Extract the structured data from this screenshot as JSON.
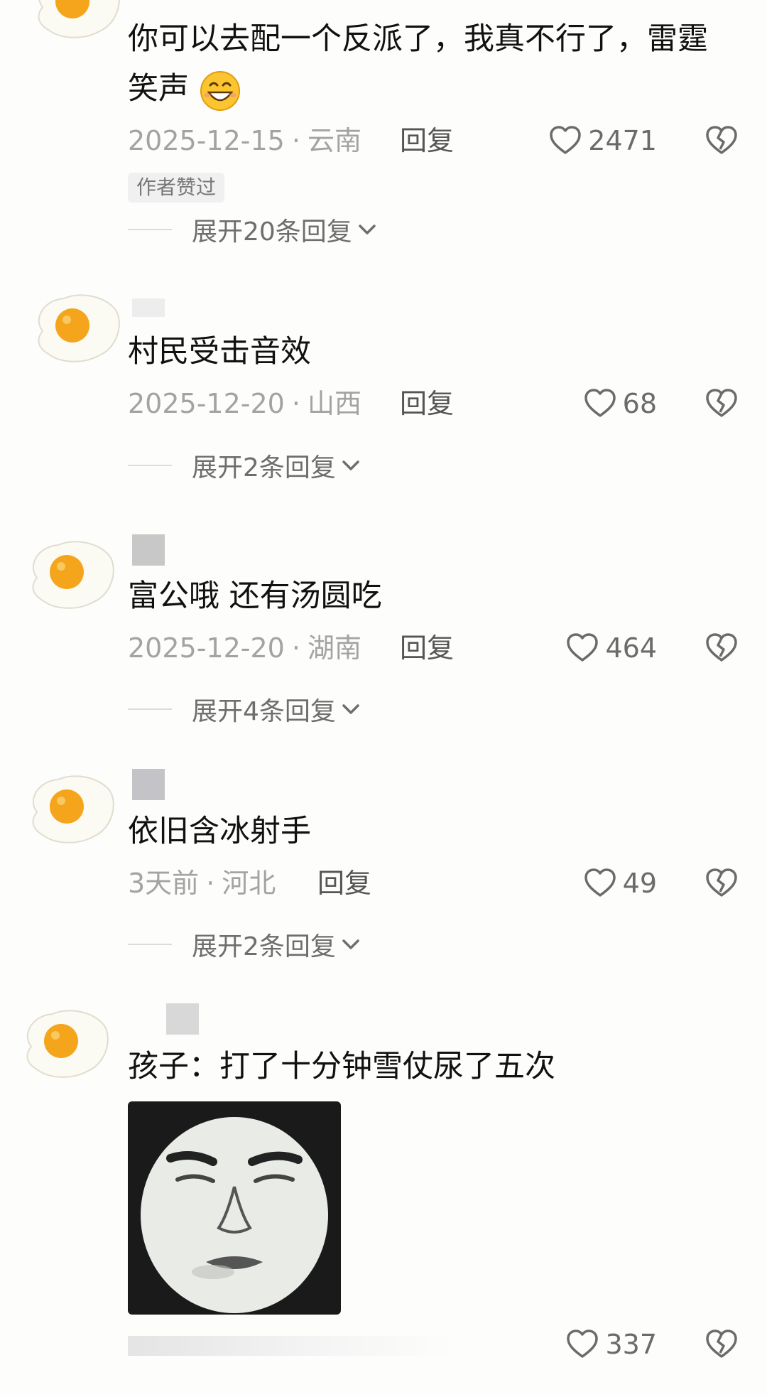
{
  "comments": [
    {
      "text": "你可以去配一个反派了，我真不行了，雷霆笑声",
      "emoji": "grinning-face-emoji",
      "date": "2025-12-15",
      "location": "云南",
      "reply_label": "回复",
      "likes": "2471",
      "badge": "作者赞过",
      "expand": "展开20条回复"
    },
    {
      "text": "村民受击音效",
      "date": "2025-12-20",
      "location": "山西",
      "reply_label": "回复",
      "likes": "68",
      "expand": "展开2条回复"
    },
    {
      "text": "富公哦 还有汤圆吃",
      "date": "2025-12-20",
      "location": "湖南",
      "reply_label": "回复",
      "likes": "464",
      "expand": "展开4条回复"
    },
    {
      "text": "依旧含冰射手",
      "date": "3天前",
      "location": "河北",
      "reply_label": "回复",
      "likes": "49",
      "expand": "展开2条回复"
    },
    {
      "text": "孩子：打了十分钟雪仗尿了五次",
      "sticker": "panda-face-meme-sticker",
      "likes": "337"
    }
  ],
  "separator": "·",
  "icons": {
    "like": "heart-outline-icon",
    "dislike": "broken-heart-icon",
    "expand": "chevron-down-icon",
    "avatar": "fried-egg-avatar"
  },
  "colors": {
    "background": "#fdfdfb",
    "text": "#111111",
    "meta": "#a3a3a3",
    "egg_yolk": "#f4a51c"
  }
}
